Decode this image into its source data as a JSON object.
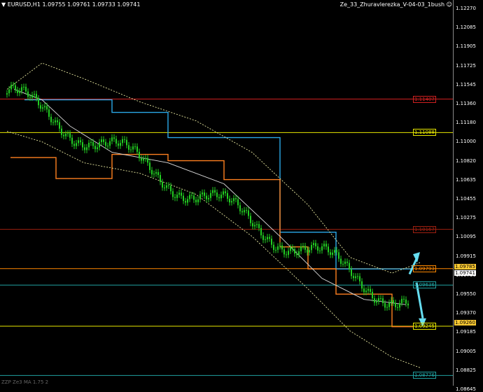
{
  "header": {
    "menu_icon": "triangle-down-icon",
    "symbol_info": "EURUSD,H1  1.09755 1.09761 1.09733 1.09741",
    "indicator_name": "Ze_33_Zhuravlerezka_V-04-03_1bush",
    "smiley_icon": "smiley-icon"
  },
  "axis": {
    "ticks": [
      "1.12270",
      "1.12085",
      "1.11905",
      "1.11725",
      "1.11545",
      "1.11360",
      "1.11180",
      "1.11000",
      "1.10820",
      "1.10635",
      "1.10455",
      "1.10275",
      "1.10095",
      "1.09915",
      "1.09730",
      "1.09550",
      "1.09370",
      "1.09185",
      "1.09005",
      "1.08825",
      "1.08645"
    ],
    "current_price_upper": "1.09785",
    "current_price_lower": "1.09741",
    "price_box_bottom": "1.09260"
  },
  "levels": [
    {
      "label": "1.11407",
      "price": 1.11407,
      "color": "#d02020"
    },
    {
      "label": "1.11088",
      "price": 1.11088,
      "color": "#e8e800"
    },
    {
      "label": "1.10167",
      "price": 1.10167,
      "color": "#a02010"
    },
    {
      "label": "1.09793",
      "price": 1.09793,
      "color": "#ff8800"
    },
    {
      "label": "1.09636",
      "price": 1.09636,
      "color": "#20a0a0"
    },
    {
      "label": "1.09245",
      "price": 1.09245,
      "color": "#e8e800"
    },
    {
      "label": "1.08776",
      "price": 1.08776,
      "color": "#20a0a0"
    }
  ],
  "colors": {
    "blue_step": "#2aa8e8",
    "orange_step": "#ff8020",
    "yellow_step": "#e8e800",
    "candles": "#22cc22",
    "arrow": "#66ddf0",
    "band": "#e8e8a0"
  },
  "footer": {
    "text": "ZZP Ze3 MA 1.75 2"
  }
}
